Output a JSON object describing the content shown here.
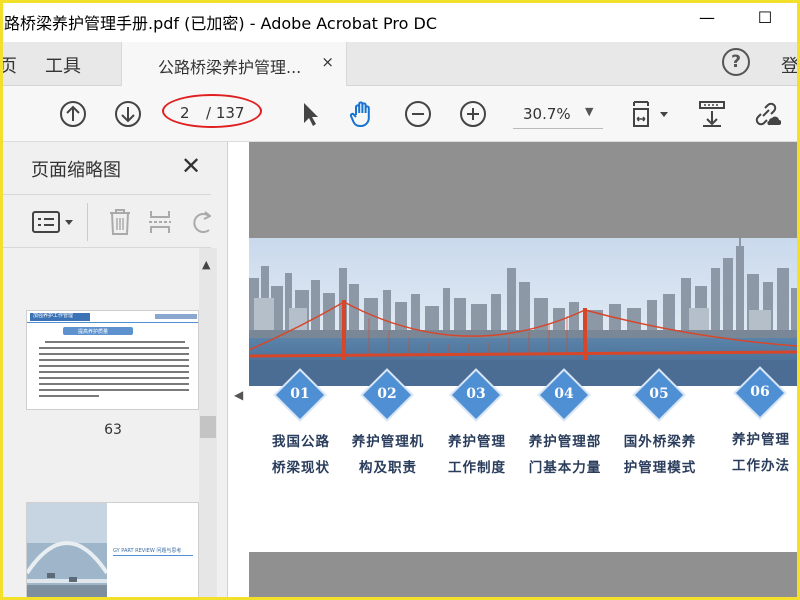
{
  "window": {
    "title": "路桥梁养护管理手册.pdf (已加密) - Adobe Acrobat Pro DC",
    "minimize_glyph": "—",
    "maximize_glyph": "☐"
  },
  "tabs": {
    "home_fragment": "页",
    "tools": "工具",
    "document_tab": "公路桥梁养护管理...",
    "close_glyph": "×",
    "help_glyph": "?",
    "signin_fragment": "登"
  },
  "toolbar": {
    "page_current": "2",
    "page_total": "/ 137",
    "zoom_value": "30.7%",
    "zoom_caret": "▼"
  },
  "left_panel": {
    "title": "页面缩略图",
    "close_glyph": "✕",
    "thumbnail_1_label": "63",
    "thumbnail_1_heading": "加强养护工作管理",
    "thumbnail_1_box": "提高养护质量",
    "thumbnail_2_caption": "GY PART REVIEW 问题与思考"
  },
  "document": {
    "items": [
      {
        "num": "01",
        "line1": "我国公路",
        "line2": "桥梁现状"
      },
      {
        "num": "02",
        "line1": "养护管理机",
        "line2": "构及职责"
      },
      {
        "num": "03",
        "line1": "养护管理",
        "line2": "工作制度"
      },
      {
        "num": "04",
        "line1": "养护管理部",
        "line2": "门基本力量"
      },
      {
        "num": "05",
        "line1": "国外桥梁养",
        "line2": "护管理模式"
      },
      {
        "num": "06",
        "line1": "养护管理",
        "line2": "工作办法"
      }
    ]
  },
  "colors": {
    "accent_blue": "#4f8fd4",
    "highlight_oval": "#e02020",
    "frame_yellow": "#f2e02a",
    "bridge_red": "#d8462a"
  },
  "icons": [
    "page-up-icon",
    "page-down-icon",
    "select-arrow-icon",
    "hand-tool-icon",
    "zoom-out-icon",
    "zoom-in-icon",
    "page-fit-icon",
    "scroll-mode-icon",
    "share-link-icon",
    "help-icon",
    "options-icon",
    "delete-icon",
    "insert-icon",
    "rotate-icon"
  ]
}
